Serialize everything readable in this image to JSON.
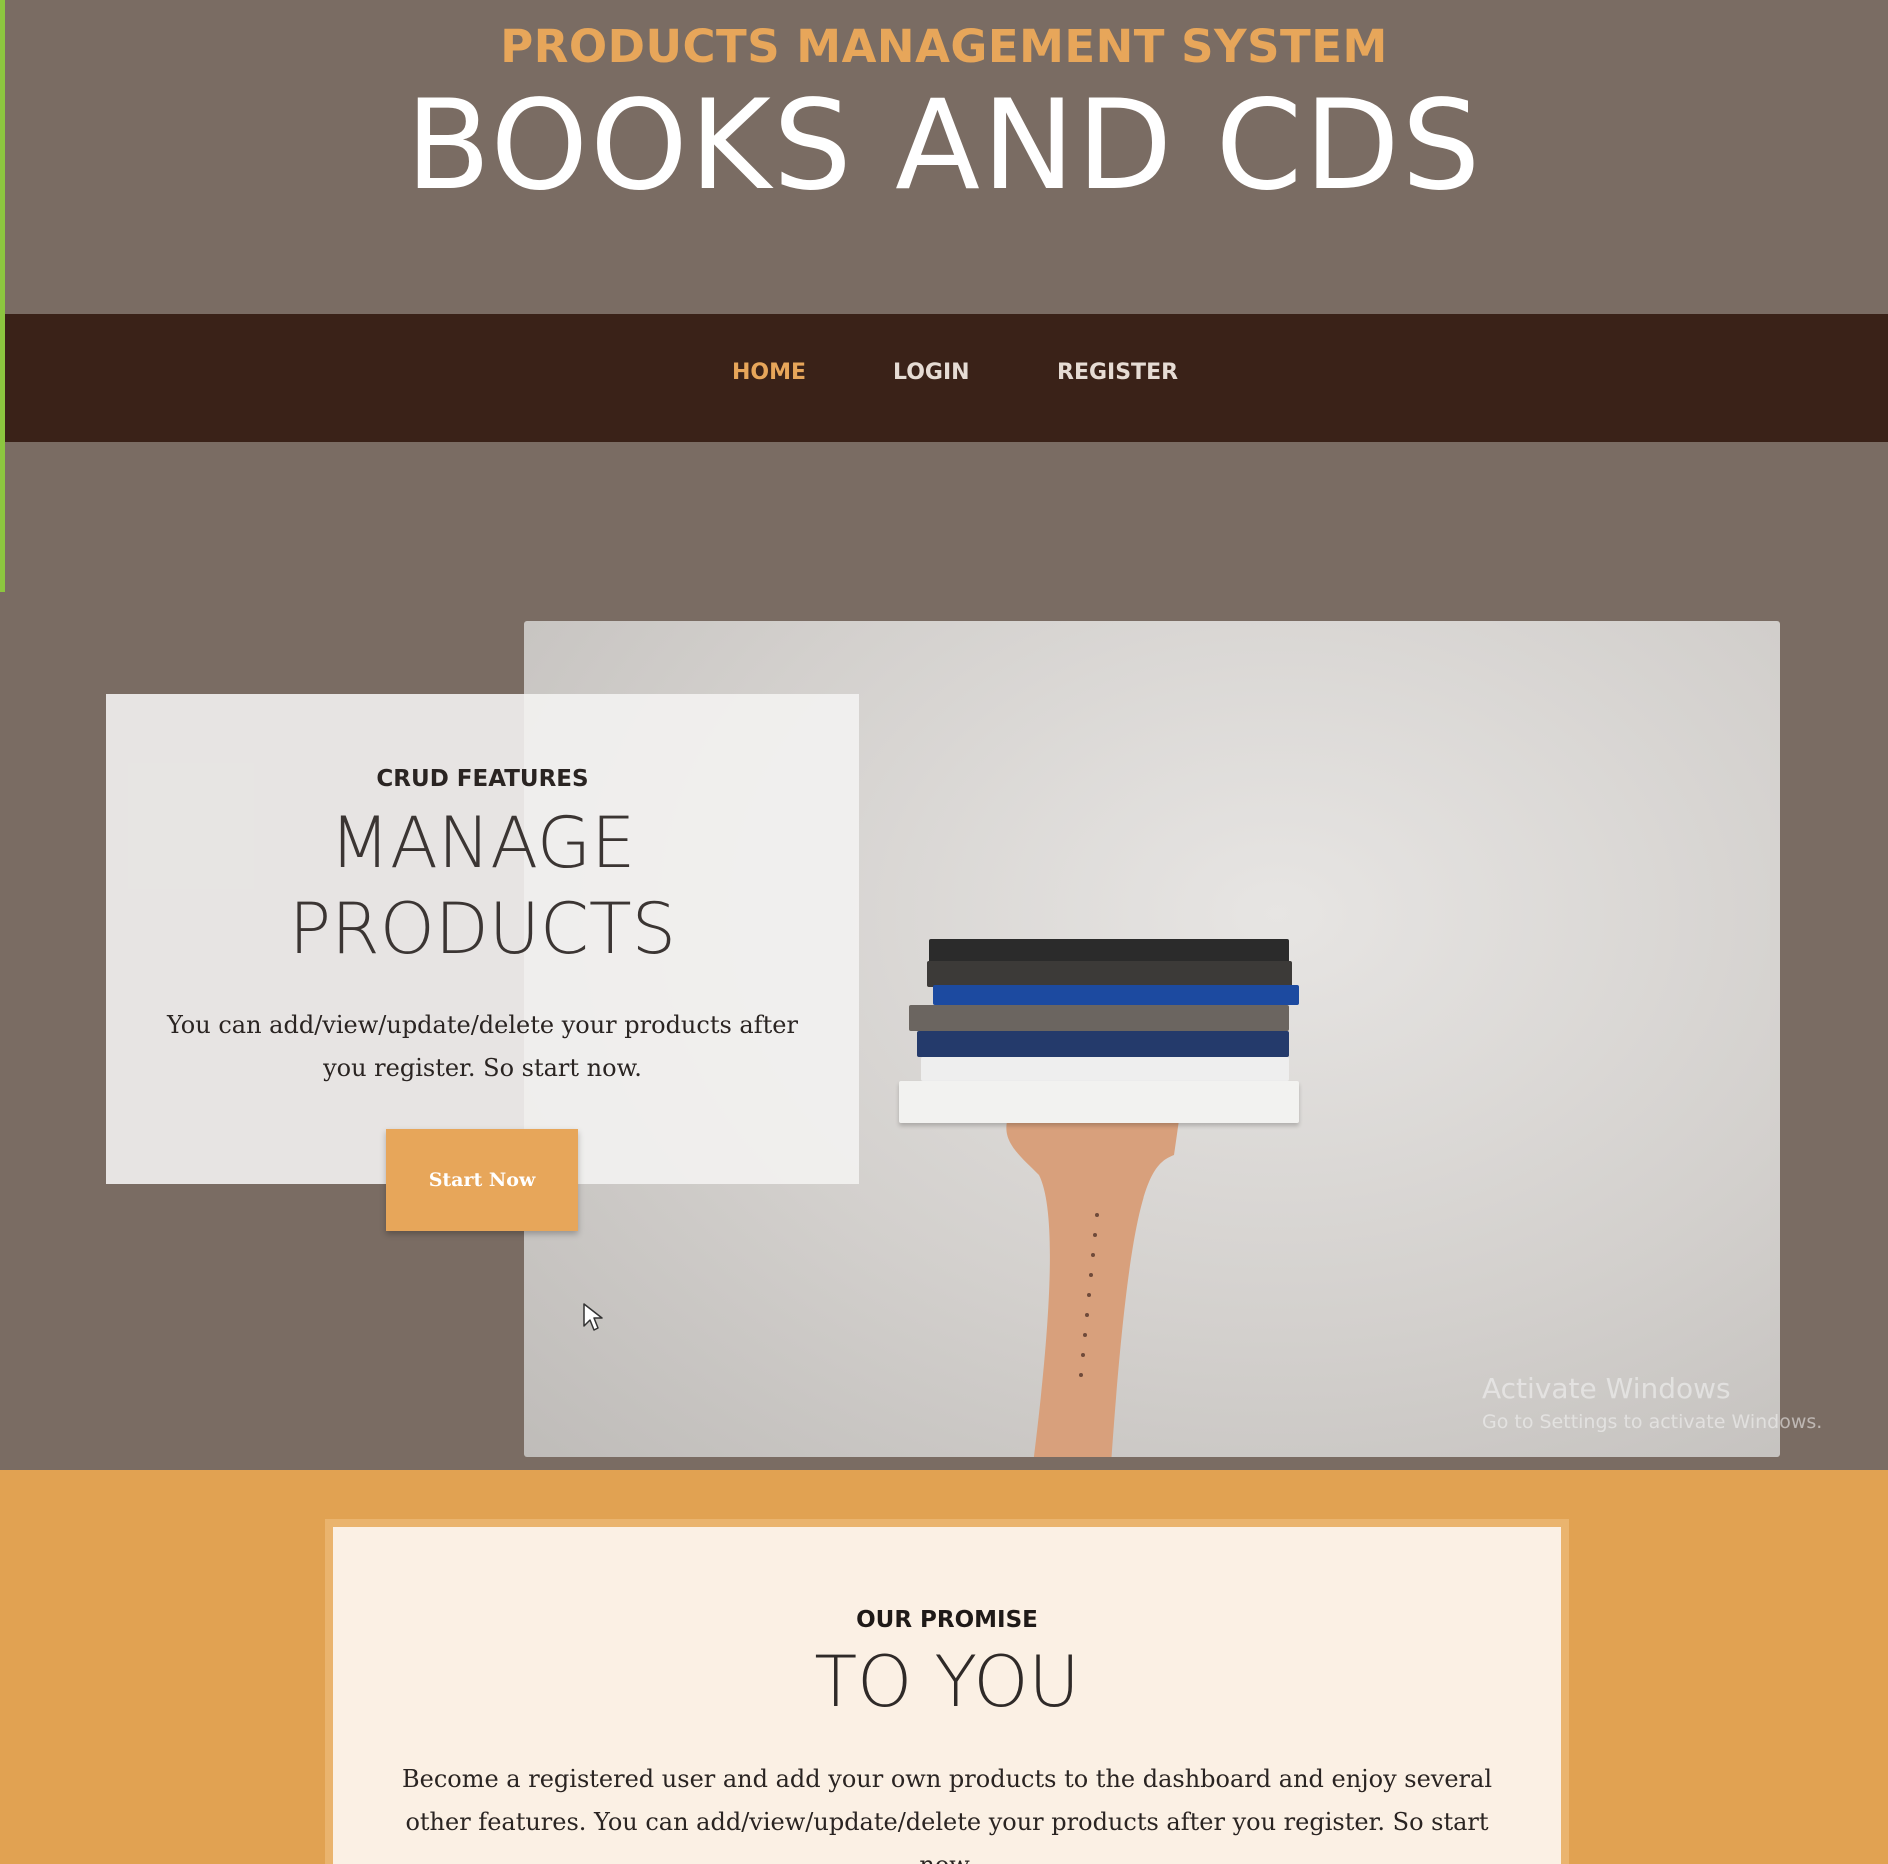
{
  "colors": {
    "accent": "#e7a65a",
    "nav_bg": "#3a2218",
    "header_bg": "#7a6c63",
    "promise_band": "#e1a252",
    "green_edge": "#8cc63f"
  },
  "header": {
    "subtitle": "PRODUCTS MANAGEMENT SYSTEM",
    "title": "BOOKS AND CDS"
  },
  "nav": {
    "home": "HOME",
    "login": "LOGIN",
    "register": "REGISTER",
    "active": "HOME"
  },
  "hero": {
    "eyebrow": "CRUD FEATURES",
    "title_line1": "MANAGE",
    "title_line2": "PRODUCTS",
    "text": "You can add/view/update/delete your products after you register. So start now.",
    "button": "Start Now",
    "image": "books-stack-photo"
  },
  "watermark": {
    "title": "Activate Windows",
    "subtitle": "Go to Settings to activate Windows."
  },
  "promise": {
    "eyebrow": "OUR PROMISE",
    "title": "TO YOU",
    "text": "Become a registered user and add your own products to the dashboard and enjoy several other features. You can add/view/update/delete your products after you register. So start now."
  },
  "icons": {
    "cursor": "mouse-pointer-icon"
  }
}
